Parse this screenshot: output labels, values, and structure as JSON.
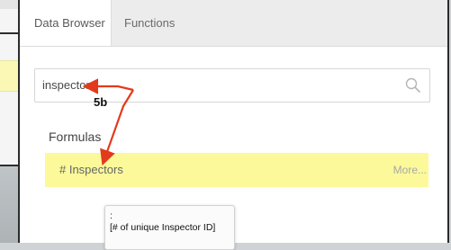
{
  "tabs": [
    {
      "label": "Data Browser",
      "active": true
    },
    {
      "label": "Functions",
      "active": false
    }
  ],
  "search": {
    "value": "inspectors",
    "icon": "search-icon"
  },
  "formulas": {
    "title": "Formulas",
    "items": [
      {
        "name": "# Inspectors",
        "more_label": "More..."
      }
    ]
  },
  "tooltip": {
    "line1": ":",
    "line2": "[# of unique Inspector ID]"
  },
  "annotation": {
    "label": "5b",
    "color": "#e23a1c"
  },
  "colors": {
    "highlight": "#fbf99a",
    "tab_bar": "#ececec"
  }
}
